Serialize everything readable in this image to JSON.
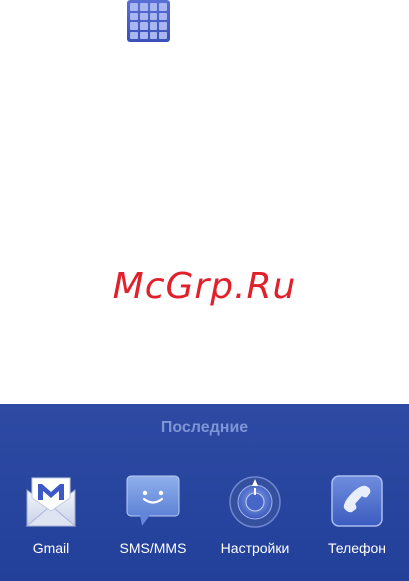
{
  "watermark": "McGrp.Ru",
  "recent_panel": {
    "title": "Последние",
    "apps": [
      {
        "label": "Gmail",
        "icon": "gmail-icon"
      },
      {
        "label": "SMS/MMS",
        "icon": "sms-icon"
      },
      {
        "label": "Настройки",
        "icon": "settings-icon"
      },
      {
        "label": "Телефон",
        "icon": "phone-icon"
      }
    ]
  },
  "colors": {
    "panel": "#2a46a0",
    "panel_title": "#7f95d6",
    "watermark": "#e0202a"
  }
}
